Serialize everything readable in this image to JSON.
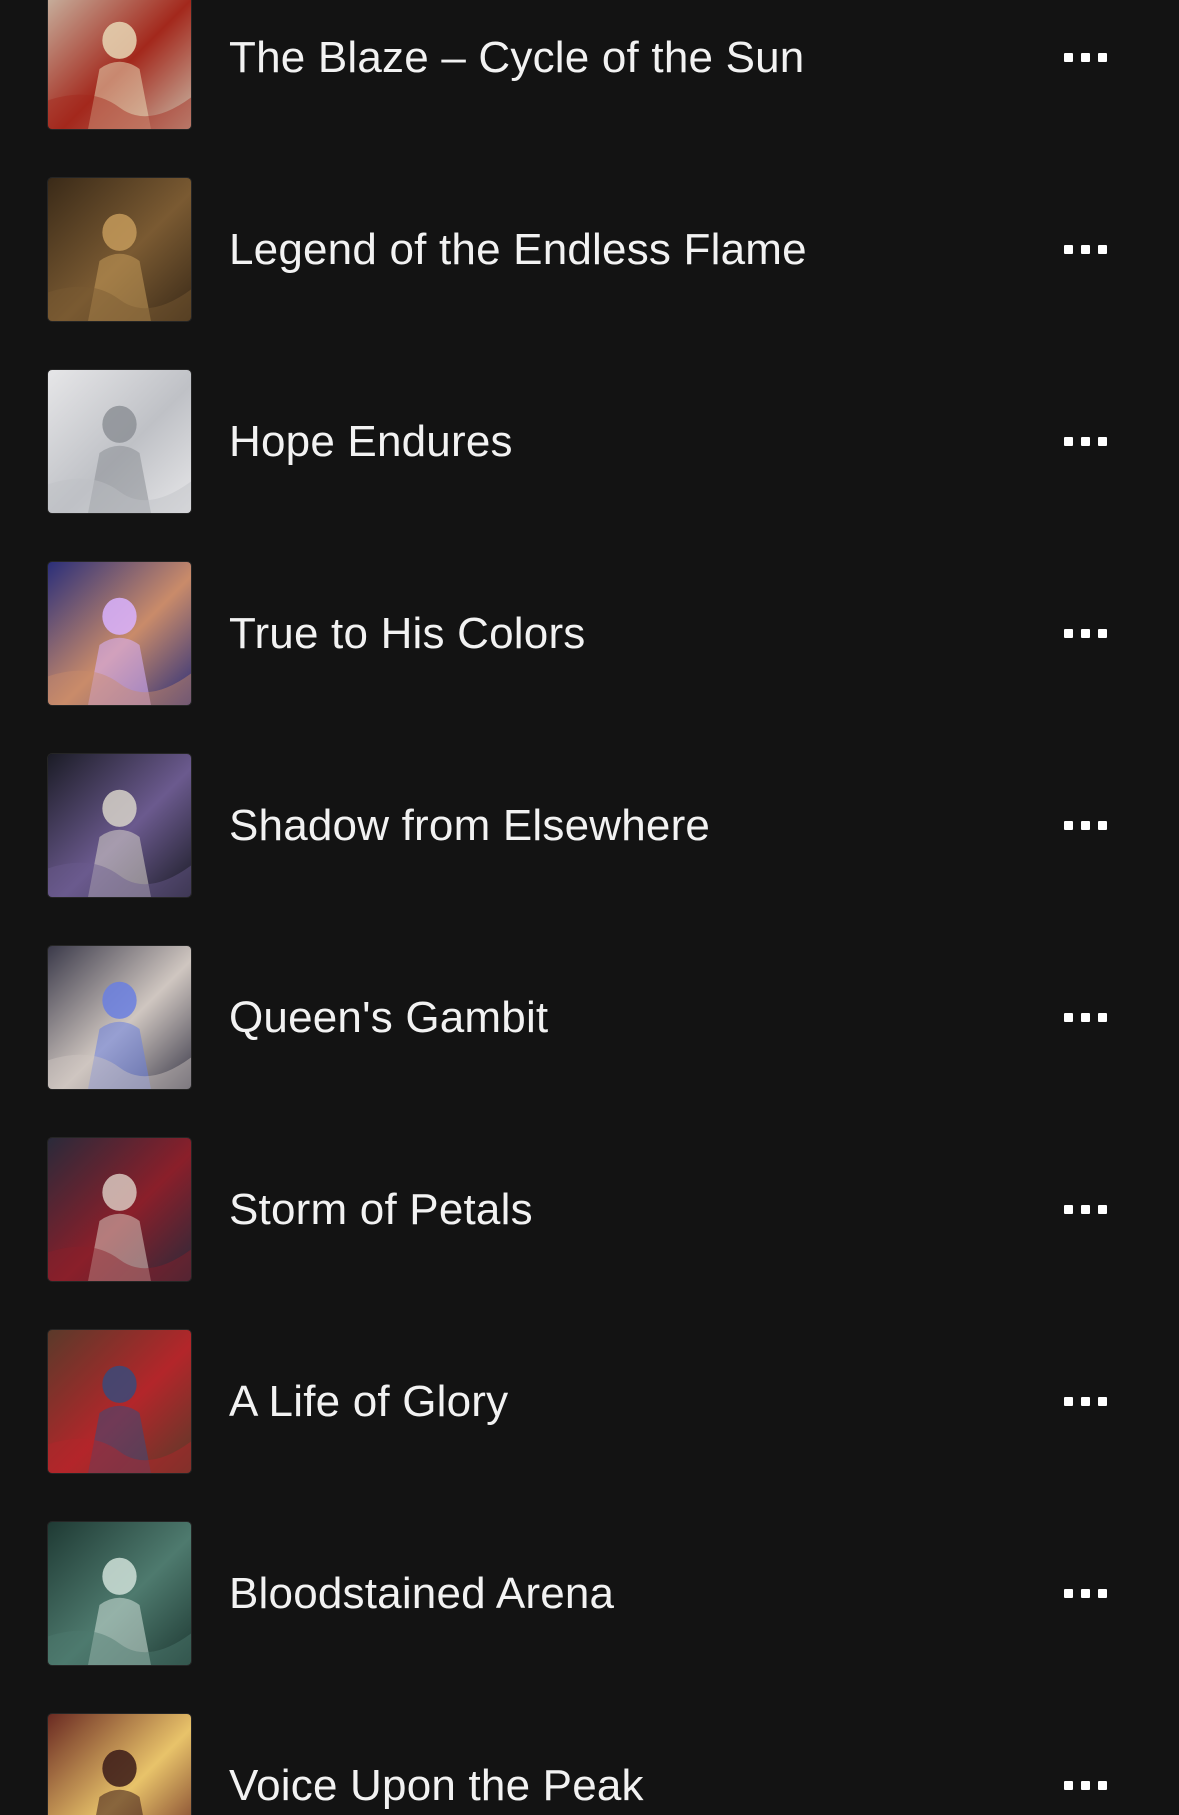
{
  "tracks": [
    {
      "title": "The Blaze – Cycle of the Sun",
      "art": "thumb-blaze",
      "colors": [
        "#c9b9a6",
        "#a3281c",
        "#e8d7b5"
      ]
    },
    {
      "title": "Legend of the Endless Flame",
      "art": "thumb-flame",
      "colors": [
        "#3a2a18",
        "#7a5a32",
        "#c49a5a"
      ]
    },
    {
      "title": "Hope Endures",
      "art": "thumb-hope",
      "colors": [
        "#e6e6e8",
        "#bfc1c6",
        "#8d9096"
      ]
    },
    {
      "title": "True to His Colors",
      "art": "thumb-colors",
      "colors": [
        "#2b2f7a",
        "#c98b6a",
        "#d9b3ff"
      ]
    },
    {
      "title": "Shadow from Elsewhere",
      "art": "thumb-shadow",
      "colors": [
        "#1b1c26",
        "#6b5a8e",
        "#d7d2c9"
      ]
    },
    {
      "title": "Queen's Gambit",
      "art": "thumb-queen",
      "colors": [
        "#3b3a4a",
        "#cfc6c0",
        "#6a7fe0"
      ]
    },
    {
      "title": "Storm of Petals",
      "art": "thumb-petals",
      "colors": [
        "#2a2a3a",
        "#8a1f2a",
        "#d9c8c0"
      ]
    },
    {
      "title": "A Life of Glory",
      "art": "thumb-glory",
      "colors": [
        "#5a3a2a",
        "#b3262a",
        "#3a4a7a"
      ]
    },
    {
      "title": "Bloodstained Arena",
      "art": "thumb-arena",
      "colors": [
        "#1f3a34",
        "#4e7a6e",
        "#cfe0d8"
      ]
    },
    {
      "title": "Voice Upon the Peak",
      "art": "thumb-peak",
      "colors": [
        "#6a2a22",
        "#e8c36a",
        "#3a1a18"
      ]
    }
  ],
  "more_icon": "ellipsis-icon"
}
